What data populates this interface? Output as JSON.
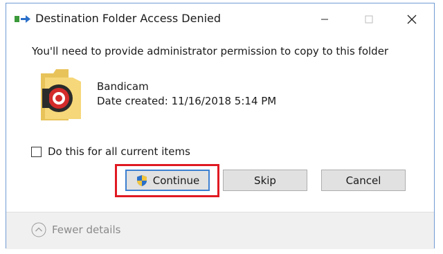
{
  "window": {
    "title": "Destination Folder Access Denied",
    "icon": "copy-arrow-icon",
    "controls": [
      "minimize-icon",
      "maximize-icon",
      "close-icon"
    ]
  },
  "message": "You'll need to provide administrator permission to copy to this folder",
  "file": {
    "name": "Bandicam",
    "date_created": "Date created: 11/16/2018 5:14 PM",
    "icon": "folder-icon"
  },
  "checkbox": {
    "label": "Do this for all current items",
    "checked": false
  },
  "buttons": {
    "continue_label": "Continue",
    "skip_label": "Skip",
    "cancel_label": "Cancel"
  },
  "footer": {
    "details_label": "Fewer details"
  },
  "colors": {
    "window_border": "#6f9bd2",
    "highlight": "#e01922",
    "default_button_border": "#3c7fd0",
    "button_face": "#e1e1e1",
    "footer_bg": "#f0f0f0"
  }
}
